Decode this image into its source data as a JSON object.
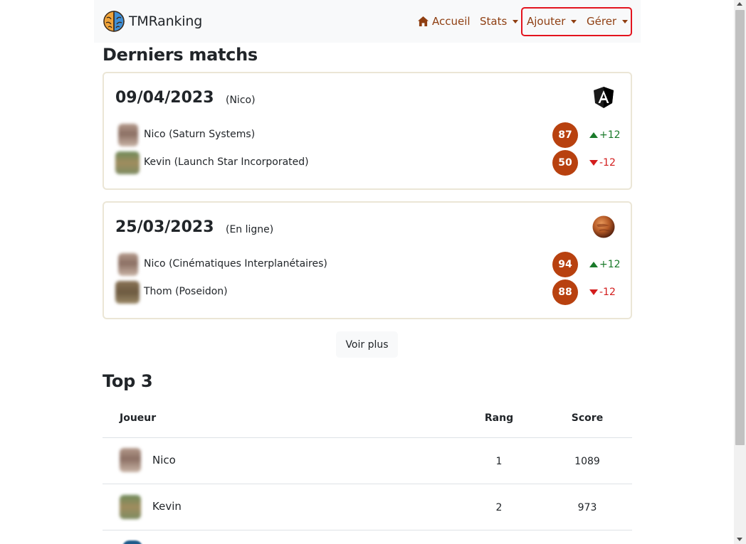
{
  "navbar": {
    "brand": "TMRanking",
    "home_label": "Accueil",
    "stats_label": "Stats",
    "add_label": "Ajouter",
    "manage_label": "Gérer"
  },
  "matches": {
    "title": "Derniers matchs",
    "cards": [
      {
        "date": "09/04/2023",
        "subtitle": "(Nico)",
        "icon": "angular-shield-icon",
        "players": [
          {
            "name": "Nico (Saturn Systems)",
            "score": "87",
            "delta": "+12",
            "trend": "up"
          },
          {
            "name": "Kevin (Launch Star Incorporated)",
            "score": "50",
            "delta": "-12",
            "trend": "down"
          }
        ]
      },
      {
        "date": "25/03/2023",
        "subtitle": "(En ligne)",
        "icon": "mars-planet-icon",
        "players": [
          {
            "name": "Nico (Cinématiques Interplanétaires)",
            "score": "94",
            "delta": "+12",
            "trend": "up"
          },
          {
            "name": "Thom (Poseidon)",
            "score": "88",
            "delta": "-12",
            "trend": "down"
          }
        ]
      }
    ],
    "more_label": "Voir plus"
  },
  "top3": {
    "title": "Top 3",
    "headers": {
      "player": "Joueur",
      "rank": "Rang",
      "score": "Score"
    },
    "rows": [
      {
        "name": "Nico",
        "rank": "1",
        "score": "1089"
      },
      {
        "name": "Kevin",
        "rank": "2",
        "score": "973"
      }
    ]
  },
  "colors": {
    "accent": "#8f3f12",
    "badge": "#b8410f",
    "positive": "#1a7a2a",
    "negative": "#d31d1d",
    "highlight": "#e3141e"
  }
}
